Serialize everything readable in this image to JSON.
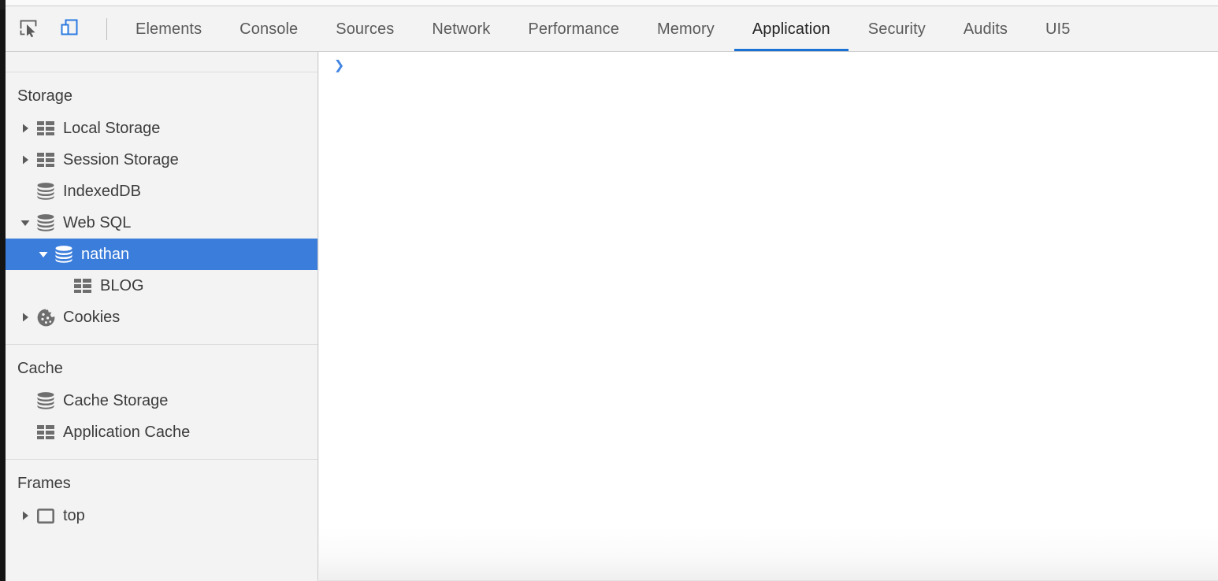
{
  "toolbar": {
    "inspect_icon": "inspect-element-icon",
    "device_icon": "device-toolbar-icon"
  },
  "tabs": [
    {
      "label": "Elements",
      "active": false
    },
    {
      "label": "Console",
      "active": false
    },
    {
      "label": "Sources",
      "active": false
    },
    {
      "label": "Network",
      "active": false
    },
    {
      "label": "Performance",
      "active": false
    },
    {
      "label": "Memory",
      "active": false
    },
    {
      "label": "Application",
      "active": true
    },
    {
      "label": "Security",
      "active": false
    },
    {
      "label": "Audits",
      "active": false
    },
    {
      "label": "UI5",
      "active": false
    }
  ],
  "sidebar": {
    "sections": [
      {
        "title": "Storage",
        "items": [
          {
            "label": "Local Storage",
            "icon": "table-icon",
            "twisty": "collapsed",
            "indent": 1,
            "selected": false
          },
          {
            "label": "Session Storage",
            "icon": "table-icon",
            "twisty": "collapsed",
            "indent": 1,
            "selected": false
          },
          {
            "label": "IndexedDB",
            "icon": "database-icon",
            "twisty": "none",
            "indent": 1,
            "selected": false
          },
          {
            "label": "Web SQL",
            "icon": "database-icon",
            "twisty": "expanded",
            "indent": 1,
            "selected": false
          },
          {
            "label": "nathan",
            "icon": "database-icon",
            "twisty": "expanded",
            "indent": 2,
            "selected": true
          },
          {
            "label": "BLOG",
            "icon": "table-icon",
            "twisty": "none",
            "indent": 3,
            "selected": false
          },
          {
            "label": "Cookies",
            "icon": "cookie-icon",
            "twisty": "collapsed",
            "indent": 1,
            "selected": false
          }
        ]
      },
      {
        "title": "Cache",
        "items": [
          {
            "label": "Cache Storage",
            "icon": "database-icon",
            "twisty": "none",
            "indent": 1,
            "selected": false
          },
          {
            "label": "Application Cache",
            "icon": "table-icon",
            "twisty": "none",
            "indent": 1,
            "selected": false
          }
        ]
      },
      {
        "title": "Frames",
        "items": [
          {
            "label": "top",
            "icon": "frame-icon",
            "twisty": "collapsed",
            "indent": 1,
            "selected": false
          }
        ]
      }
    ]
  },
  "main": {
    "console_prompt": "❯"
  },
  "colors": {
    "selection_blue": "#3b7ddb",
    "accent_blue": "#1a73d4",
    "prompt_blue": "#4285e4",
    "panel_bg": "#f3f3f3",
    "content_bg": "#ffffff",
    "text": "#3c3c3c"
  }
}
